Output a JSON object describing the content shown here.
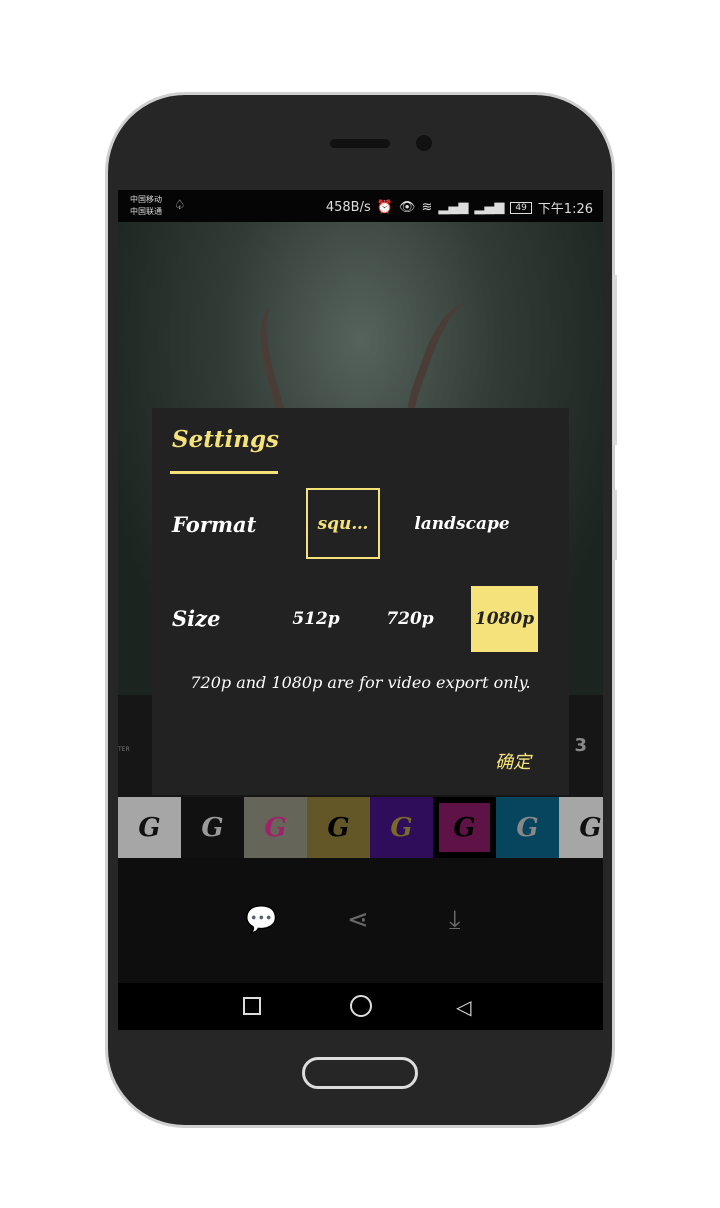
{
  "status_bar": {
    "carrier1": "中国移动",
    "carrier2": "中国联通",
    "speed": "458B/s",
    "battery": "49",
    "time": "下午1:26"
  },
  "background": {
    "side_number": "3",
    "filter_label": "TER"
  },
  "swatches": [
    {
      "bg": "#a6a6a6",
      "fg": "#111"
    },
    {
      "bg": "#111111",
      "fg": "#9a9a9a"
    },
    {
      "bg": "#65655a",
      "fg": "#a0206a"
    },
    {
      "bg": "#635727",
      "fg": "#000"
    },
    {
      "bg": "#300d5a",
      "fg": "#7a6a2a"
    },
    {
      "bg": "#5f1245",
      "fg": "#000",
      "selected": true
    },
    {
      "bg": "#07445e",
      "fg": "#888"
    },
    {
      "bg": "#a6a6a6",
      "fg": "#111"
    }
  ],
  "swatch_glyph": "G",
  "dialog": {
    "title": "Settings",
    "format_label": "Format",
    "format_options": [
      "squ…",
      "landscape"
    ],
    "format_selected": 0,
    "size_label": "Size",
    "size_options": [
      "512p",
      "720p",
      "1080p"
    ],
    "size_selected": 2,
    "note": "720p and 1080p are for video export only.",
    "ok": "确定",
    "accent": "#f5e27a"
  }
}
